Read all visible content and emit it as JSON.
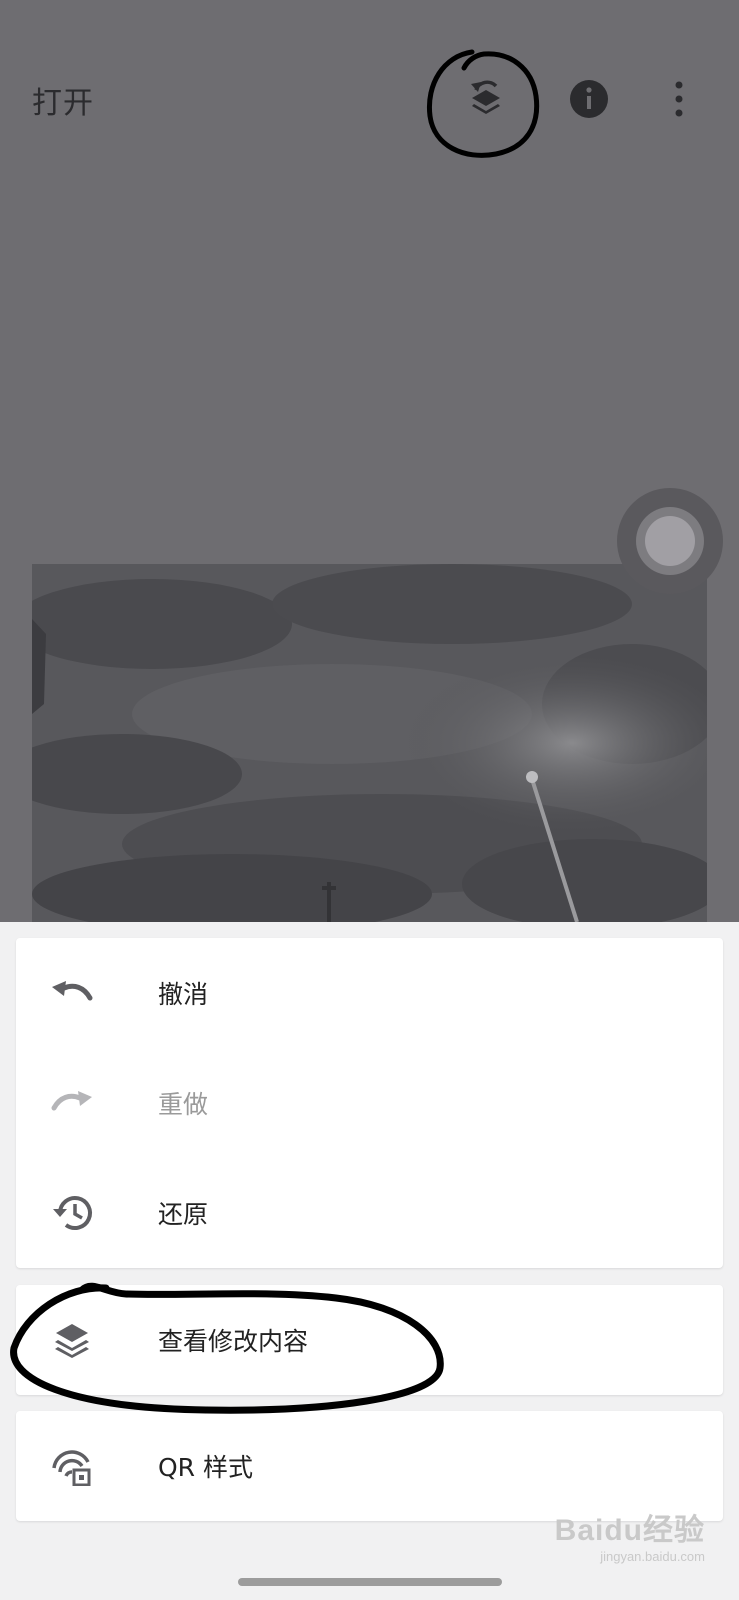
{
  "app_bar": {
    "title": "打开",
    "icons": [
      "layers-undo-icon",
      "info-icon",
      "more-vert-icon"
    ]
  },
  "menu": {
    "primary_items": [
      {
        "icon": "undo-icon",
        "label": "撤消",
        "enabled": true
      },
      {
        "icon": "redo-icon",
        "label": "重做",
        "enabled": false
      },
      {
        "icon": "history-restore-icon",
        "label": "还原",
        "enabled": true
      }
    ],
    "view_edits": {
      "icon": "layers-icon",
      "label": "查看修改内容"
    },
    "qr_style": {
      "icon": "qr-style-icon",
      "label": "QR 样式"
    }
  },
  "watermark": {
    "main": "Baidu经验",
    "sub": "jingyan.baidu.com"
  },
  "colors": {
    "overlay": "#6e6d71",
    "sheet_background": "#f1f1f2",
    "card": "#ffffff",
    "text_primary": "#222222",
    "text_disabled": "#9a9a9a",
    "annotation_ink": "#000000"
  }
}
